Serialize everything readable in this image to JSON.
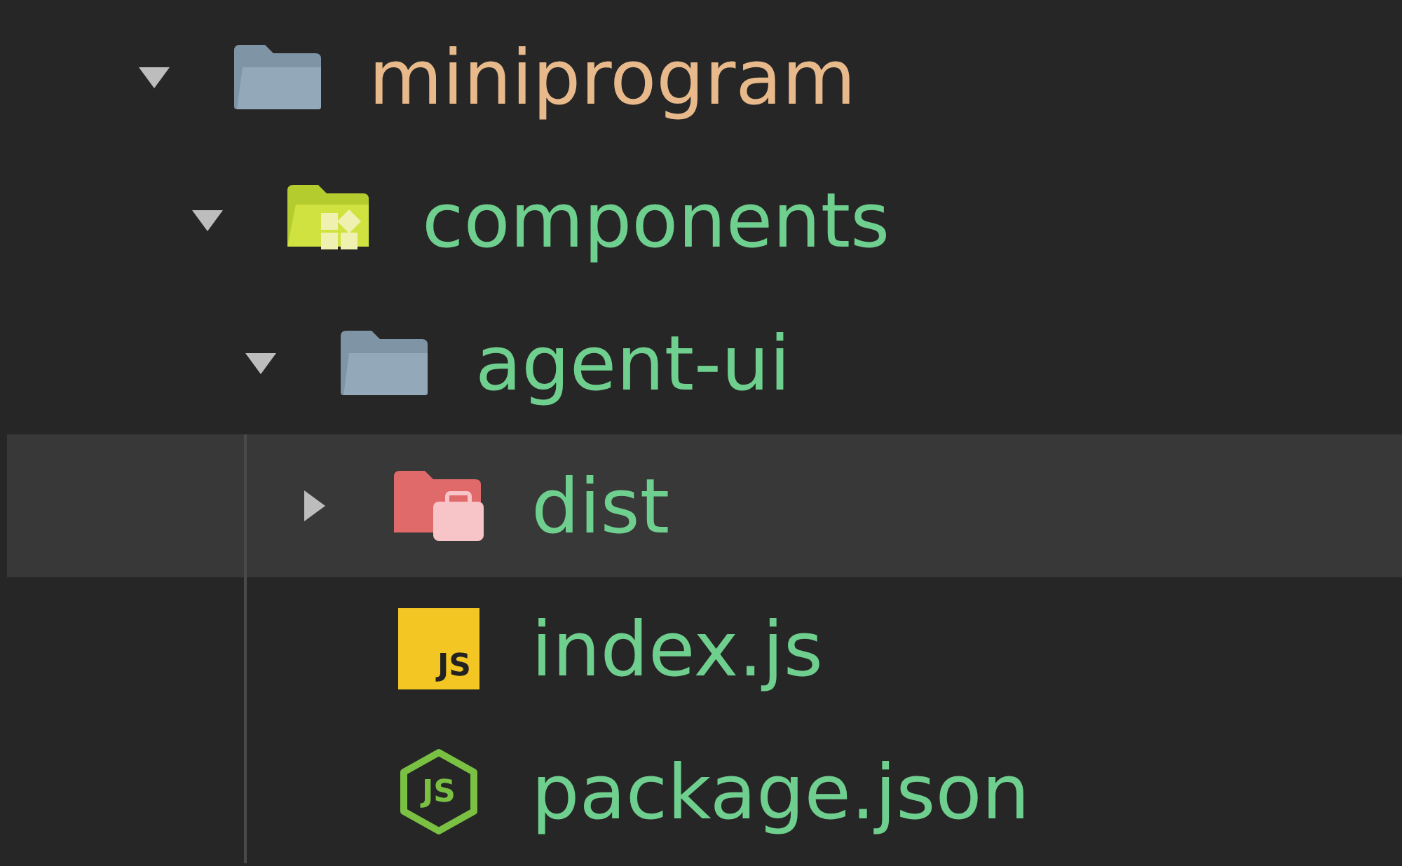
{
  "tree": [
    {
      "name": "miniprogram",
      "kind": "folder",
      "expanded": true,
      "selected": false,
      "color": "#e8b98a",
      "children": [
        {
          "name": "components",
          "kind": "component-folder",
          "expanded": true,
          "selected": false,
          "color": "#6fcf8e",
          "children": [
            {
              "name": "agent-ui",
              "kind": "folder",
              "expanded": true,
              "selected": false,
              "color": "#6fcf8e",
              "children": [
                {
                  "name": "dist",
                  "kind": "dist-folder",
                  "expanded": false,
                  "selected": true,
                  "color": "#6fcf8e"
                },
                {
                  "name": "index.js",
                  "kind": "js",
                  "icon_text": "JS",
                  "selected": false,
                  "color": "#6fcf8e"
                },
                {
                  "name": "package.json",
                  "kind": "node-js",
                  "icon_text": "JS",
                  "selected": false,
                  "color": "#6fcf8e"
                }
              ]
            }
          ]
        }
      ]
    }
  ]
}
